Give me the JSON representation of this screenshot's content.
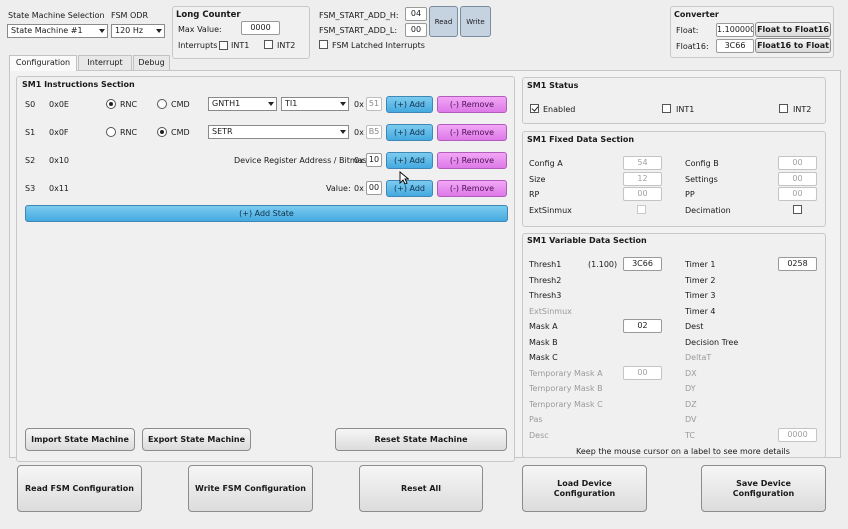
{
  "top": {
    "sm_selection_label": "State Machine Selection",
    "sm_selection_value": "State Machine #1",
    "odr_label": "FSM ODR",
    "odr_value": "120 Hz",
    "long_counter_title": "Long Counter",
    "max_value_label": "Max Value:",
    "max_value": "0000",
    "interrupts_label": "Interrupts",
    "int1": "INT1",
    "int2": "INT2",
    "start_add_h_label": "FSM_START_ADD_H:",
    "start_add_h": "04",
    "start_add_l_label": "FSM_START_ADD_L:",
    "start_add_l": "00",
    "latched_label": "FSM Latched Interrupts",
    "read_btn": "Read",
    "write_btn": "Write",
    "converter_title": "Converter",
    "float_label": "Float:",
    "float_value": "1.100000",
    "float_to_f16": "Float to Float16",
    "float16_label": "Float16:",
    "float16_value": "3C66",
    "f16_to_float": "Float16 to Float"
  },
  "tabs": [
    "Configuration",
    "Interrupt",
    "Debug"
  ],
  "instructions": {
    "title": "SM1 Instructions Section",
    "rnc": "RNC",
    "cmd": "CMD",
    "hex_prefix": "0x",
    "add_label": "(+) Add",
    "remove_label": "(-) Remove",
    "rows": [
      {
        "state": "S0",
        "addr": "0x0E",
        "select1": "GNTH1",
        "select2": "TI1",
        "value": "51"
      },
      {
        "state": "S1",
        "addr": "0x0F",
        "select1": "SETR",
        "value": "B5"
      },
      {
        "state": "S2",
        "addr": "0x10",
        "text": "Device Register Address / Bitmask:",
        "value": "10"
      },
      {
        "state": "S3",
        "addr": "0x11",
        "text": "Value:",
        "value": "00"
      }
    ],
    "add_state": "(+) Add State"
  },
  "bottom_left": {
    "import": "Import State Machine",
    "export": "Export State Machine",
    "reset_sm": "Reset State Machine"
  },
  "status": {
    "title": "SM1 Status",
    "enabled": "Enabled",
    "int1": "INT1",
    "int2": "INT2"
  },
  "fixed": {
    "title": "SM1 Fixed Data Section",
    "config_a": "Config A",
    "config_a_val": "54",
    "size": "Size",
    "size_val": "12",
    "rp": "RP",
    "rp_val": "00",
    "extsinmux": "ExtSinmux",
    "config_b": "Config B",
    "config_b_val": "00",
    "settings": "Settings",
    "settings_val": "00",
    "pp": "PP",
    "pp_val": "00",
    "decimation": "Decimation"
  },
  "variable": {
    "title": "SM1 Variable Data Section",
    "thresh1": "Thresh1",
    "thresh1_hint": "(1.100)",
    "thresh1_val": "3C66",
    "thresh2": "Thresh2",
    "thresh3": "Thresh3",
    "extsinmux": "ExtSinmux",
    "mask_a": "Mask A",
    "mask_a_val": "02",
    "mask_b": "Mask B",
    "mask_c": "Mask C",
    "tmask_a": "Temporary Mask A",
    "tmask_a_val": "00",
    "tmask_b": "Temporary Mask B",
    "tmask_c": "Temporary Mask C",
    "pas": "Pas",
    "desc": "Desc",
    "timer1": "Timer 1",
    "timer1_val": "0258",
    "timer2": "Timer 2",
    "timer3": "Timer 3",
    "timer4": "Timer 4",
    "dest": "Dest",
    "decision_tree": "Decision Tree",
    "deltat": "DeltaT",
    "dx": "DX",
    "dy": "DY",
    "dz": "DZ",
    "dv": "DV",
    "tc": "TC",
    "tc_val": "0000",
    "hint": "Keep the mouse cursor on a label to see more details"
  },
  "footer": {
    "read_fsm": "Read FSM Configuration",
    "write_fsm": "Write FSM Configuration",
    "reset_all": "Reset All",
    "load_device": "Load Device Configuration",
    "save_device": "Save Device Configuration"
  }
}
